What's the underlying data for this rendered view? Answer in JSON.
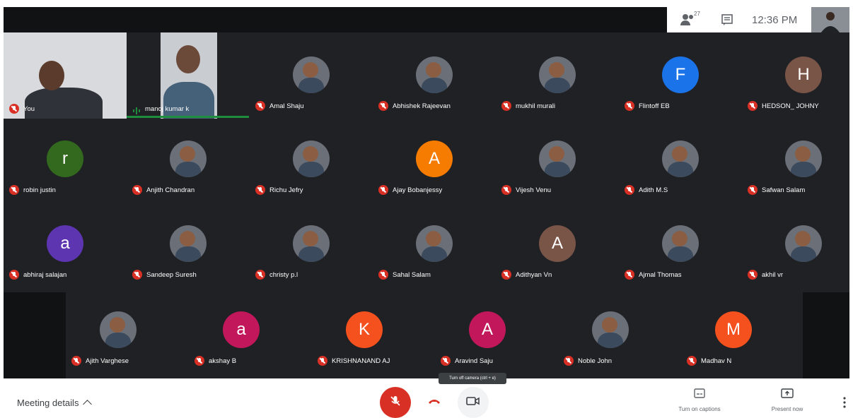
{
  "topbar": {
    "people_count": "27",
    "time": "12:36 PM",
    "icons": [
      "people-icon",
      "chat-icon"
    ]
  },
  "video_tiles": [
    {
      "name": "You",
      "muted": true
    },
    {
      "name": "manoj kumar k",
      "muted": false,
      "speaking": true
    }
  ],
  "participants": [
    {
      "name": "Amal Shaju",
      "avatar_type": "photo"
    },
    {
      "name": "Abhishek Rajeevan",
      "avatar_type": "photo"
    },
    {
      "name": "mukhil murali",
      "avatar_type": "photo"
    },
    {
      "name": "Flintoff EB",
      "avatar_type": "letter",
      "letter": "F",
      "color": "#1a73e8"
    },
    {
      "name": "HEDSON_ JOHNY",
      "avatar_type": "letter",
      "letter": "H",
      "color": "#795548"
    },
    {
      "name": "robin justin",
      "avatar_type": "letter",
      "letter": "r",
      "color": "#33691e"
    },
    {
      "name": "Anjith Chandran",
      "avatar_type": "photo"
    },
    {
      "name": "Richu Jefry",
      "avatar_type": "photo"
    },
    {
      "name": "Ajay Bobanjessy",
      "avatar_type": "letter",
      "letter": "A",
      "color": "#f57c00"
    },
    {
      "name": "Vijesh Venu",
      "avatar_type": "photo"
    },
    {
      "name": "Adith M.S",
      "avatar_type": "photo"
    },
    {
      "name": "Safwan Salam",
      "avatar_type": "photo"
    },
    {
      "name": "abhiraj salajan",
      "avatar_type": "letter",
      "letter": "a",
      "color": "#5e35b1"
    },
    {
      "name": "Sandeep Suresh",
      "avatar_type": "photo"
    },
    {
      "name": "christy p.l",
      "avatar_type": "photo"
    },
    {
      "name": "Sahal Salam",
      "avatar_type": "photo"
    },
    {
      "name": "Adithyan Vn",
      "avatar_type": "letter",
      "letter": "A",
      "color": "#795548"
    },
    {
      "name": "Ajmal Thomas",
      "avatar_type": "photo"
    },
    {
      "name": "akhil vr",
      "avatar_type": "photo"
    },
    {
      "name": "Ajith Varghese",
      "avatar_type": "photo"
    },
    {
      "name": "akshay B",
      "avatar_type": "letter",
      "letter": "a",
      "color": "#c2185b"
    },
    {
      "name": "KRISHNANAND AJ",
      "avatar_type": "letter",
      "letter": "K",
      "color": "#f4511e"
    },
    {
      "name": "Aravind Saju",
      "avatar_type": "letter",
      "letter": "A",
      "color": "#c2185b"
    },
    {
      "name": "Noble John",
      "avatar_type": "photo"
    },
    {
      "name": "Madhav N",
      "avatar_type": "letter",
      "letter": "M",
      "color": "#f4511e"
    }
  ],
  "bottombar": {
    "meeting_details": "Meeting details",
    "tooltip": "Turn off camera (ctrl + e)",
    "captions_label": "Turn on captions",
    "present_label": "Present now"
  },
  "colors": {
    "stage_bg": "#202124",
    "muted_red": "#d93025",
    "speaking_green": "#1e8e3e"
  }
}
